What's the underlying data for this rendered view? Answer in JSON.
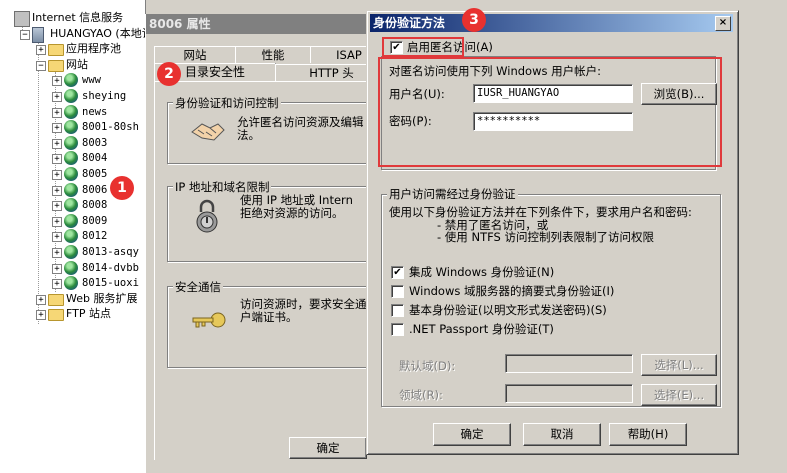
{
  "tree": {
    "items": [
      {
        "label": "Internet 信息服务",
        "kind": "iis",
        "pm": ""
      },
      {
        "label": "HUANGYAO (本地计",
        "kind": "server",
        "pm": "−"
      },
      {
        "label": "应用程序池",
        "kind": "folder",
        "pm": "+"
      },
      {
        "label": "网站",
        "kind": "folder",
        "pm": "−"
      },
      {
        "label": "www",
        "kind": "globe",
        "pm": "+"
      },
      {
        "label": "sheying",
        "kind": "globe",
        "pm": "+"
      },
      {
        "label": "news",
        "kind": "globe",
        "pm": "+"
      },
      {
        "label": "8001-80sh",
        "kind": "globe",
        "pm": "+"
      },
      {
        "label": "8003",
        "kind": "globe",
        "pm": "+"
      },
      {
        "label": "8004",
        "kind": "globe",
        "pm": "+"
      },
      {
        "label": "8005",
        "kind": "globe",
        "pm": "+"
      },
      {
        "label": "8006",
        "kind": "globe",
        "pm": "+"
      },
      {
        "label": "8008",
        "kind": "globe",
        "pm": "+"
      },
      {
        "label": "8009",
        "kind": "globe",
        "pm": "+"
      },
      {
        "label": "8012",
        "kind": "globe",
        "pm": "+"
      },
      {
        "label": "8013-asqy",
        "kind": "globe",
        "pm": "+"
      },
      {
        "label": "8014-dvbb",
        "kind": "globe",
        "pm": "+"
      },
      {
        "label": "8015-uoxi",
        "kind": "globe",
        "pm": "+"
      },
      {
        "label": "Web 服务扩展",
        "kind": "folder",
        "pm": "+"
      },
      {
        "label": "FTP 站点",
        "kind": "folder",
        "pm": "+"
      }
    ]
  },
  "site_dialog": {
    "title": "8006 属性",
    "tabs_row1": [
      "网站",
      "性能",
      "ISAP"
    ],
    "tabs_row2": [
      "目录安全性",
      "HTTP 头"
    ],
    "group_auth": {
      "title": "身份验证和访问控制",
      "text": "允许匿名访问资源及编辑\n法。"
    },
    "group_ip": {
      "title": "IP 地址和域名限制",
      "text": "使用 IP 地址或 Intern\n拒绝对资源的访问。"
    },
    "group_secure": {
      "title": "安全通信",
      "text": "访问资源时，要求安全通\n户端证书。"
    },
    "ok_label": "确定"
  },
  "auth_dialog": {
    "title": "身份验证方法",
    "close_label": "×",
    "enable_anon_label": "启用匿名访问(A)",
    "enable_anon_checked": true,
    "anon_desc": "对匿名访问使用下列 Windows 用户帐户:",
    "username_label": "用户名(U):",
    "username_value": "IUSR_HUANGYAO",
    "browse_label": "浏览(B)...",
    "password_label": "密码(P):",
    "password_value": "**********",
    "auth_group_title": "用户访问需经过身份验证",
    "auth_group_desc": "使用以下身份验证方法并在下列条件下，要求用户名和密码:",
    "auth_cond1": "- 禁用了匿名访问，或",
    "auth_cond2": "- 使用 NTFS 访问控制列表限制了访问权限",
    "options": [
      {
        "label": "集成 Windows 身份验证(N)",
        "checked": true
      },
      {
        "label": "Windows 域服务器的摘要式身份验证(I)",
        "checked": false
      },
      {
        "label": "基本身份验证(以明文形式发送密码)(S)",
        "checked": false
      },
      {
        "label": ".NET Passport 身份验证(T)",
        "checked": false
      }
    ],
    "default_domain_label": "默认域(D):",
    "realm_label": "领域(R):",
    "select_label": "选择(L)...",
    "select2_label": "选择(E)...",
    "ok_label": "确定",
    "cancel_label": "取消",
    "help_label": "帮助(H)"
  },
  "badges": [
    "1",
    "2",
    "3"
  ],
  "colors": {
    "highlight": "#e0393b",
    "titlebar_start": "#0a246a",
    "titlebar_end": "#a6caf0"
  }
}
